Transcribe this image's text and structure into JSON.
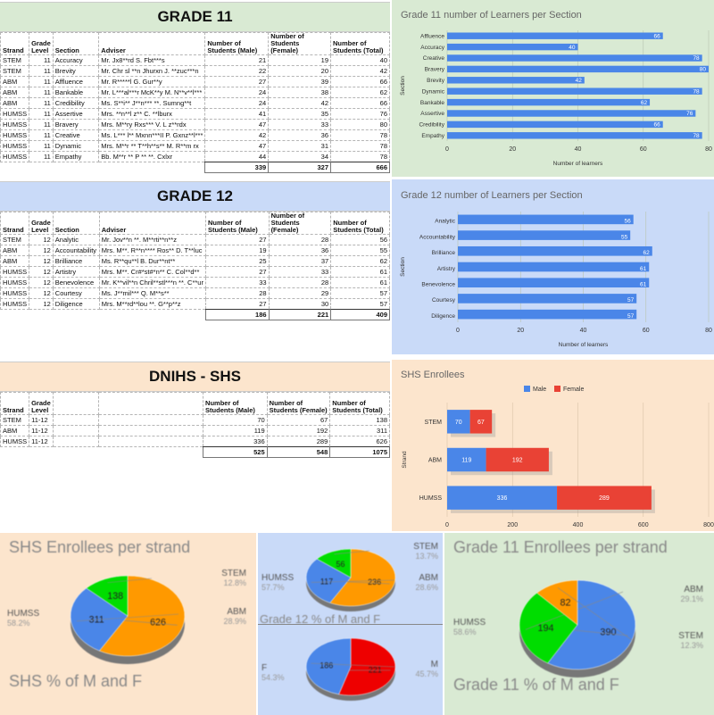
{
  "grade11": {
    "title": "GRADE 11",
    "headers": [
      "Strand",
      "Grade Level",
      "Section",
      "Adviser",
      "Number of Students (Male)",
      "Number of Students (Female)",
      "Number of Students (Total)"
    ],
    "rows": [
      [
        "STEM",
        "11",
        "Accuracy",
        "Mr. Jx8**rd S. Fbt***s",
        "21",
        "19",
        "40"
      ],
      [
        "STEM",
        "11",
        "Brevity",
        "Mr. Chr sl **n Jhurxn J. **zuc***n",
        "22",
        "20",
        "42"
      ],
      [
        "ABM",
        "11",
        "Affluence",
        "Mr. R*****l G. Gur**y",
        "27",
        "39",
        "66"
      ],
      [
        "ABM",
        "11",
        "Bankable",
        "Mr. L***al***r McK**y M. N**v**l***",
        "24",
        "38",
        "62"
      ],
      [
        "ABM",
        "11",
        "Credibility",
        "Ms. S**i** J**n*** **. Sumng**t",
        "24",
        "42",
        "66"
      ],
      [
        "HUMSS",
        "11",
        "Assertive",
        "Mrs. **n**l z** C. **lburx",
        "41",
        "35",
        "76"
      ],
      [
        "HUMSS",
        "11",
        "Bravery",
        "Mrs. M**ry Rxs*** V. L z**rdx",
        "47",
        "33",
        "80"
      ],
      [
        "HUMSS",
        "11",
        "Creative",
        "Ms. L*** l** Mxnn***II P. Gxnz**l***",
        "42",
        "36",
        "78"
      ],
      [
        "HUMSS",
        "11",
        "Dynamic",
        "Mrs. M**r ** T**h**s** M. R**m rx",
        "47",
        "31",
        "78"
      ],
      [
        "HUMSS",
        "11",
        "Empathy",
        "Bb. M**r ** P ** **. Cxlxr",
        "44",
        "34",
        "78"
      ]
    ],
    "totals": [
      "339",
      "327",
      "666"
    ]
  },
  "grade12": {
    "title": "GRADE 12",
    "headers": [
      "Strand",
      "Grade Level",
      "Section",
      "Adviser",
      "Number of Students (Male)",
      "Number of Students (Female)",
      "Number of Students (Total)"
    ],
    "rows": [
      [
        "STEM",
        "12",
        "Analytic",
        "Mr. Jov**n **. M**rti**n**z",
        "27",
        "28",
        "56"
      ],
      [
        "ABM",
        "12",
        "Accountability",
        "Mrs. M**. R**n**** Ros** D. T**luc",
        "19",
        "36",
        "55"
      ],
      [
        "ABM",
        "12",
        "Brilliance",
        "Ms. R**qu**l B. Dur**nt**",
        "25",
        "37",
        "62"
      ],
      [
        "HUMSS",
        "12",
        "Artistry",
        "Mrs. M**. Cr#*st#*n** C. Col**d**",
        "27",
        "33",
        "61"
      ],
      [
        "HUMSS",
        "12",
        "Benevolence",
        "Mr. K**vil**n Chril**stl***n **. C**ur",
        "33",
        "28",
        "61"
      ],
      [
        "HUMSS",
        "12",
        "Courtesy",
        "Ms. J**mil*** Q. M**s**",
        "28",
        "29",
        "57"
      ],
      [
        "HUMSS",
        "12",
        "Diligence",
        "Mrs. M**rd**lou **. G**p**z",
        "27",
        "30",
        "57"
      ]
    ],
    "totals": [
      "186",
      "221",
      "409"
    ]
  },
  "dnihs": {
    "title": "DNIHS - SHS",
    "headers": [
      "Strand",
      "Grade Level",
      "",
      "",
      "Number of Students (Male)",
      "Number of Students (Female)",
      "Number of Students (Total)"
    ],
    "rows": [
      [
        "STEM",
        "11-12",
        "",
        "",
        "70",
        "67",
        "138"
      ],
      [
        "ABM",
        "11-12",
        "",
        "",
        "119",
        "192",
        "311"
      ],
      [
        "HUMSS",
        "11-12",
        "",
        "",
        "336",
        "289",
        "626"
      ]
    ],
    "totals": [
      "525",
      "548",
      "1075"
    ]
  },
  "chart_data": [
    {
      "type": "bar",
      "title": "Grade 11 number of Learners per Section",
      "orientation": "horizontal",
      "categories": [
        "Affluence",
        "Accuracy",
        "Creative",
        "Bravery",
        "Brevity",
        "Dynamic",
        "Bankable",
        "Assertive",
        "Credibility",
        "Empathy"
      ],
      "values": [
        66,
        40,
        78,
        80,
        42,
        78,
        62,
        76,
        66,
        78
      ],
      "xlabel": "Number of learners",
      "ylabel": "Section",
      "xlim": [
        0,
        80
      ],
      "xticks": [
        "0",
        "20",
        "40",
        "60",
        "80"
      ],
      "color": "#4a86e8"
    },
    {
      "type": "bar",
      "title": "Grade 12 number of Learners per Section",
      "orientation": "horizontal",
      "categories": [
        "Analytic",
        "Accountability",
        "Brilliance",
        "Artistry",
        "Benevolence",
        "Courtesy",
        "Diligence"
      ],
      "values": [
        56,
        55,
        62,
        61,
        61,
        57,
        57
      ],
      "xlabel": "Number of learners",
      "ylabel": "Section",
      "xlim": [
        0,
        80
      ],
      "xticks": [
        "0",
        "20",
        "40",
        "60",
        "80"
      ],
      "color": "#4a86e8"
    },
    {
      "type": "bar",
      "title": "SHS Enrollees",
      "orientation": "horizontal",
      "stacked": true,
      "categories": [
        "STEM",
        "ABM",
        "HUMSS"
      ],
      "series": [
        {
          "name": "Male",
          "values": [
            70,
            119,
            336
          ],
          "color": "#4a86e8"
        },
        {
          "name": "Female",
          "values": [
            67,
            192,
            289
          ],
          "color": "#e94235"
        }
      ],
      "ylabel": "Strand",
      "xlim": [
        0,
        800
      ],
      "xticks": [
        "0",
        "200",
        "400",
        "600",
        "800"
      ],
      "legend": "top"
    },
    {
      "type": "pie",
      "title": "SHS Enrollees per strand",
      "slices": [
        {
          "label": "HUMSS",
          "value": 626,
          "pct": "58.2%",
          "color": "#ff9900"
        },
        {
          "label": "ABM",
          "value": 311,
          "pct": "28.9%",
          "color": "#4a86e8"
        },
        {
          "label": "STEM",
          "value": 138,
          "pct": "12.8%",
          "color": "#00dd00"
        }
      ]
    },
    {
      "type": "pie",
      "title": "Grade 12 % of M and F",
      "slices": [
        {
          "label": "HUMSS",
          "value": 236,
          "pct": "57.7%",
          "color": "#ff9900"
        },
        {
          "label": "ABM",
          "value": 117,
          "pct": "28.6%",
          "color": "#4a86e8"
        },
        {
          "label": "STEM",
          "value": 56,
          "pct": "13.7%",
          "color": "#00dd00"
        }
      ]
    },
    {
      "type": "pie",
      "title": "SHS % of M and F",
      "slices": [
        {
          "label": "F",
          "value": 221,
          "pct": "54.3%",
          "color": "#ee0000"
        },
        {
          "label": "M",
          "value": 186,
          "pct": "45.7%",
          "color": "#4a86e8"
        }
      ]
    },
    {
      "type": "pie",
      "title": "Grade 11 Enrollees per strand",
      "slices": [
        {
          "label": "HUMSS",
          "value": 390,
          "pct": "58.6%",
          "color": "#4a86e8"
        },
        {
          "label": "ABM",
          "value": 194,
          "pct": "29.1%",
          "color": "#00dd00"
        },
        {
          "label": "STEM",
          "value": 82,
          "pct": "12.3%",
          "color": "#ff9900"
        }
      ]
    }
  ],
  "partial_titles": {
    "g12_pie_tail": "Grade 12 % of M and F",
    "g11_pie_tail": "Grade 11 % of M and F"
  }
}
